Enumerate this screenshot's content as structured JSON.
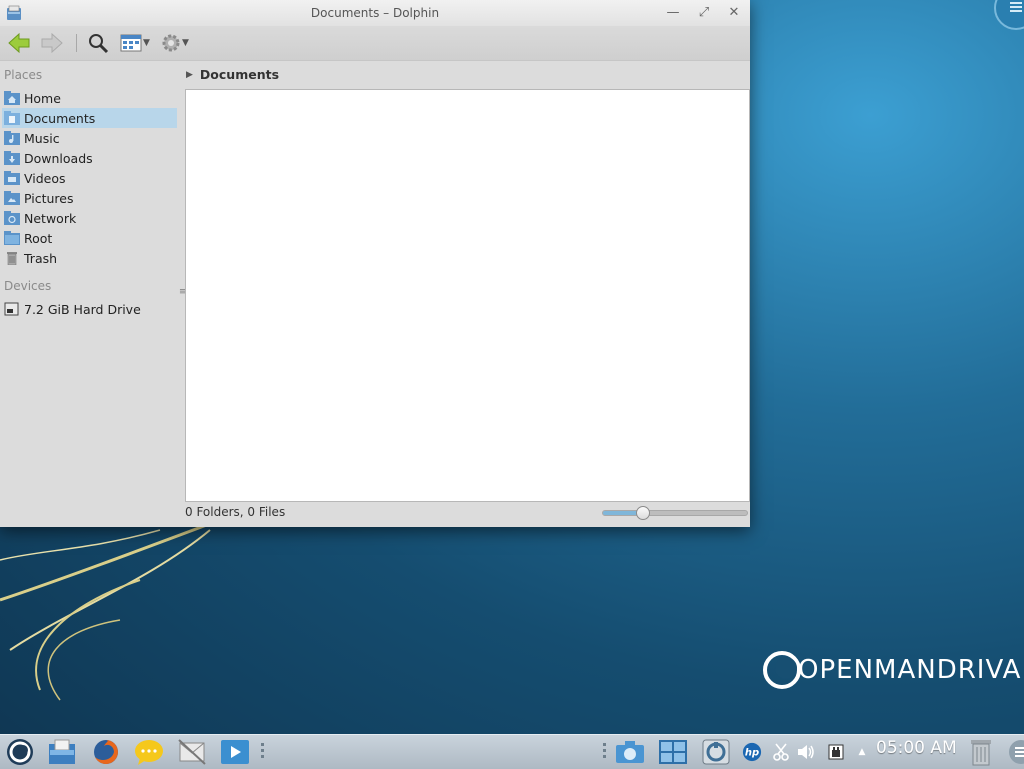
{
  "window": {
    "title": "Documents – Dolphin",
    "controls": {
      "minimize": "—",
      "maximize": "⤢",
      "close": "✕"
    }
  },
  "toolbar": {
    "back": "arrow-left-icon",
    "forward": "arrow-right-icon",
    "search": "search-icon",
    "view_mode": "view-icons-icon",
    "settings": "gear-icon"
  },
  "places": {
    "heading": "Places",
    "items": [
      {
        "label": "Home",
        "icon": "folder-home-icon",
        "selected": false
      },
      {
        "label": "Documents",
        "icon": "folder-documents-icon",
        "selected": true
      },
      {
        "label": "Music",
        "icon": "folder-music-icon",
        "selected": false
      },
      {
        "label": "Downloads",
        "icon": "folder-downloads-icon",
        "selected": false
      },
      {
        "label": "Videos",
        "icon": "folder-videos-icon",
        "selected": false
      },
      {
        "label": "Pictures",
        "icon": "folder-pictures-icon",
        "selected": false
      },
      {
        "label": "Network",
        "icon": "folder-network-icon",
        "selected": false
      },
      {
        "label": "Root",
        "icon": "folder-icon",
        "selected": false
      },
      {
        "label": "Trash",
        "icon": "trash-icon",
        "selected": false
      }
    ]
  },
  "devices": {
    "heading": "Devices",
    "items": [
      {
        "label": "7.2 GiB Hard Drive",
        "icon": "hard-drive-icon"
      }
    ]
  },
  "breadcrumb": {
    "current": "Documents"
  },
  "status": {
    "text": "0 Folders, 0 Files",
    "zoom_fraction": 0.27
  },
  "desktop": {
    "brand": "OPENMANDRIVA"
  },
  "panel": {
    "clock": "05:00 AM",
    "launchers": [
      "app-launcher-icon",
      "file-manager-icon",
      "firefox-icon",
      "chat-icon",
      "network-mail-icon",
      "media-player-icon"
    ],
    "tray": [
      "screenshot-icon",
      "desktop-switcher-icon",
      "update-icon",
      "hp-printer-icon",
      "clipboard-icon",
      "volume-icon",
      "network-icon"
    ]
  },
  "colors": {
    "selection": "#b8d6ea",
    "accent": "#7fb6d9",
    "panel": "#b9c4ce"
  }
}
